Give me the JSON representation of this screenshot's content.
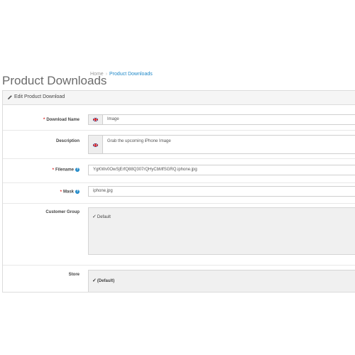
{
  "header": {
    "title": "Product Downloads",
    "breadcrumb": {
      "home": "Home",
      "separator": "›",
      "current": "Product Downloads"
    }
  },
  "panel": {
    "heading_icon": "pencil-icon",
    "heading": "Edit Product Download"
  },
  "form": {
    "download_name": {
      "label": "Download Name",
      "value": "Image",
      "required": true,
      "flag_icon": "uk-flag-icon"
    },
    "description": {
      "label": "Description",
      "value": "Grab the upcoming iPhone Image",
      "flag_icon": "uk-flag-icon"
    },
    "filename": {
      "label": "Filename",
      "value": "YgKWv0OwSjErfQ88Q307rQHyCbMfSGRQ.iphone.jpg",
      "required": true,
      "help_icon": "question-circle-icon"
    },
    "mask": {
      "label": "Mask",
      "value": "iphone.jpg",
      "required": true,
      "help_icon": "question-circle-icon"
    },
    "customer_group": {
      "label": "Customer Group",
      "options": [
        {
          "label": "Default",
          "checked": true
        }
      ]
    },
    "store": {
      "label": "Store",
      "options": [
        {
          "label": "(Default)",
          "checked": true
        }
      ]
    },
    "required_mark": "*",
    "help_glyph": "?"
  },
  "colors": {
    "accent": "#1e88c8",
    "required": "#dd2222",
    "panel_heading": "#f5f5f5",
    "well": "#f0f0f0"
  }
}
